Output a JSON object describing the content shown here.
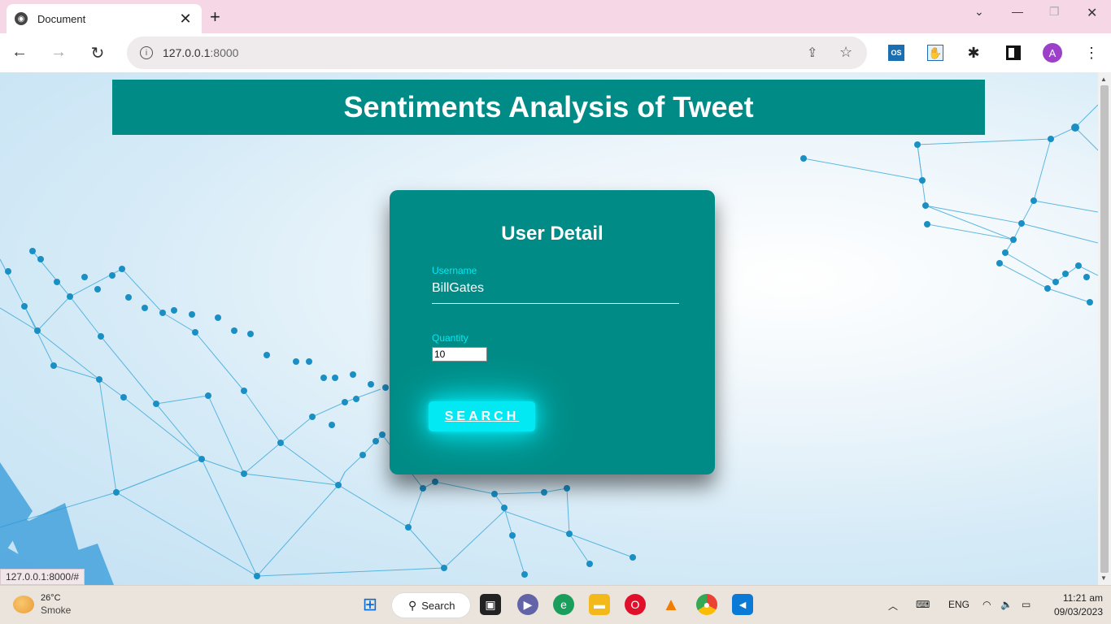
{
  "browser": {
    "tab_title": "Document",
    "url_host": "127.0.0.1",
    "url_port": ":8000",
    "status_url": "127.0.0.1:8000/#",
    "profile_initial": "A"
  },
  "page": {
    "banner_title": "Sentiments Analysis of Tweet",
    "card_title": "User Detail",
    "username_label": "Username",
    "username_value": "BillGates",
    "quantity_label": "Quantity",
    "quantity_value": "10",
    "search_label": "SEARCH"
  },
  "taskbar": {
    "weather_temp": "26°C",
    "weather_cond": "Smoke",
    "search_label": "Search",
    "lang": "ENG",
    "time": "11:21 am",
    "date": "09/03/2023"
  },
  "colors": {
    "teal": "#008b86",
    "cyan": "#03e9f4"
  }
}
